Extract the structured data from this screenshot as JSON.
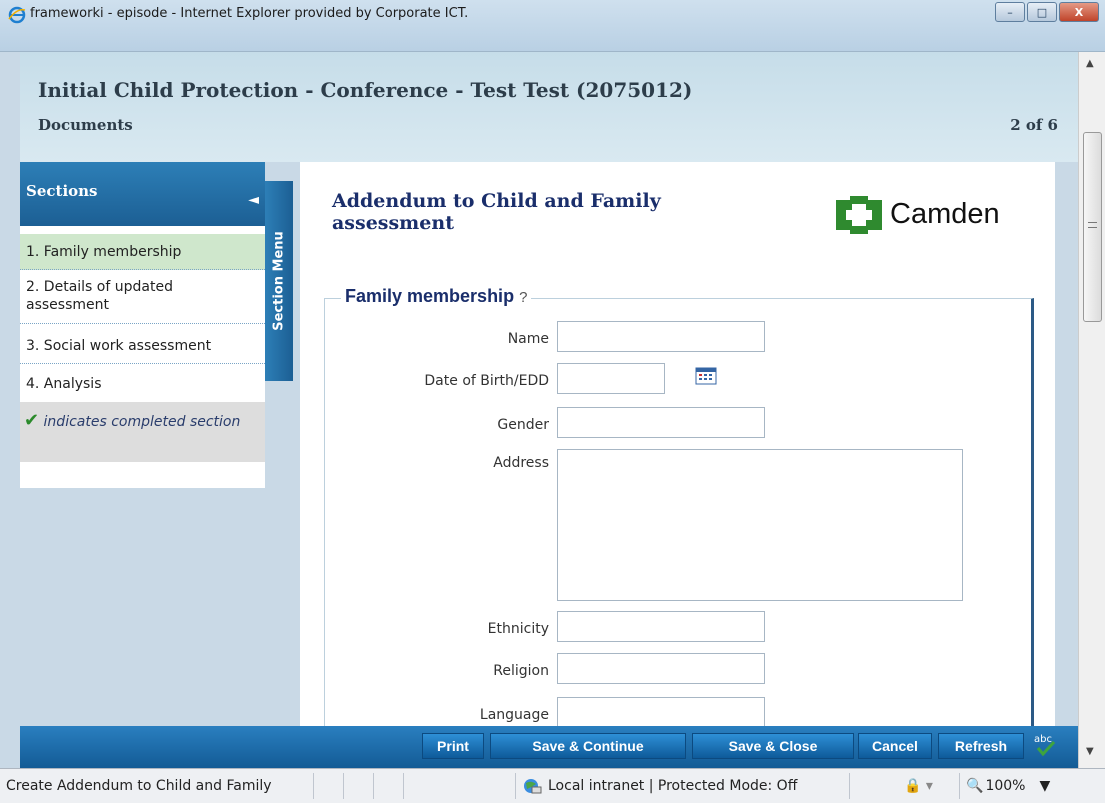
{
  "window": {
    "title": "frameworki - episode - Internet Explorer provided by Corporate ICT.",
    "minimize_label": "–",
    "maximize_label": "□",
    "close_label": "X"
  },
  "header": {
    "title": "Initial Child Protection - Conference - Test Test (2075012)",
    "subtitle": "Documents",
    "pager": "2 of 6"
  },
  "sidebar": {
    "heading": "Sections",
    "collapse_icon": "◄",
    "tab_label": "Section Menu",
    "items": [
      {
        "label": "1. Family membership"
      },
      {
        "label": "2. Details of updated assessment"
      },
      {
        "label": "3. Social work assessment"
      },
      {
        "label": "4. Analysis"
      }
    ],
    "legend_tick": "✔",
    "legend_text": "indicates completed section"
  },
  "main": {
    "document_title": "Addendum to Child and Family assessment",
    "logo_word": "Camden",
    "section_title": "Family membership",
    "help_icon": "?",
    "fields": {
      "name_label": "Name",
      "name_value": "",
      "dob_label": "Date of Birth/EDD",
      "dob_value": "",
      "gender_label": "Gender",
      "gender_value": "",
      "address_label": "Address",
      "address_value": "",
      "ethnicity_label": "Ethnicity",
      "ethnicity_value": "",
      "religion_label": "Religion",
      "religion_value": "",
      "language_label": "Language",
      "language_value": ""
    }
  },
  "toolbar": {
    "print": "Print",
    "save_continue": "Save & Continue",
    "save_close": "Save & Close",
    "cancel": "Cancel",
    "refresh": "Refresh",
    "spell_label": "abc"
  },
  "statusbar": {
    "message": "Create Addendum to Child and Family",
    "zone": "Local intranet | Protected Mode: Off",
    "zoom": "100%"
  },
  "colors": {
    "accent_blue": "#1c5f94",
    "active_item_green": "#cfe7cc",
    "title_navy": "#1a2e6b",
    "camden_green": "#2f8a2f"
  }
}
